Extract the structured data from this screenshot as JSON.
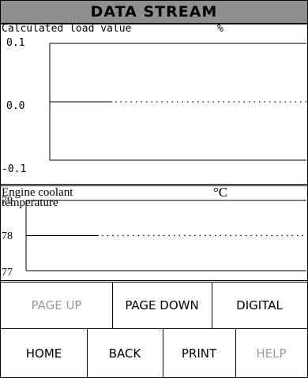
{
  "header": {
    "title": "DATA STREAM"
  },
  "charts": [
    {
      "label": "Calculated load value",
      "unit": "%",
      "y_ticks": [
        "0.1",
        "0.0",
        "-0.1"
      ]
    },
    {
      "label_line1": "Engine coolant",
      "label_line2": "temperature",
      "unit": "°C",
      "y_ticks": [
        "79",
        "78",
        "77"
      ]
    }
  ],
  "chart_data": [
    {
      "type": "line",
      "ylim": [
        -0.1,
        0.1
      ],
      "series": [
        {
          "values": [
            0.0,
            0.0
          ]
        }
      ],
      "projection_style": "dotted"
    },
    {
      "type": "line",
      "ylim": [
        77,
        79
      ],
      "series": [
        {
          "values": [
            78,
            78
          ]
        }
      ],
      "projection_style": "dotted"
    }
  ],
  "buttons": {
    "row1": [
      {
        "label": "PAGE UP",
        "enabled": false
      },
      {
        "label": "PAGE DOWN",
        "enabled": true
      },
      {
        "label": "DIGITAL",
        "enabled": true
      }
    ],
    "row2": [
      {
        "label": "HOME",
        "enabled": true
      },
      {
        "label": "BACK",
        "enabled": true
      },
      {
        "label": "PRINT",
        "enabled": true
      },
      {
        "label": "HELP",
        "enabled": false
      }
    ]
  }
}
